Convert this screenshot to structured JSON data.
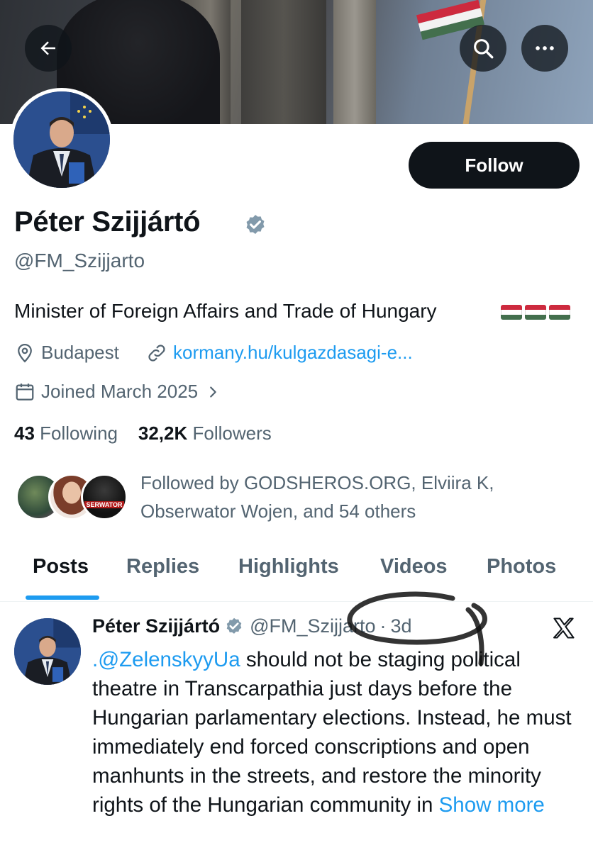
{
  "header": {
    "back_icon": "arrow-left-icon",
    "search_icon": "search-icon",
    "more_icon": "more-horizontal-icon"
  },
  "profile": {
    "name": "Péter Szijjártó",
    "handle": "@FM_Szijjarto",
    "follow_label": "Follow",
    "bio": "Minister of Foreign Affairs and Trade of Hungary",
    "bio_flags": [
      "hungary-flag",
      "hungary-flag",
      "hungary-flag"
    ],
    "location": "Budapest",
    "link": "kormany.hu/kulgazdasagi-e...",
    "joined": "Joined March 2025",
    "following_count": "43",
    "following_label": "Following",
    "followers_count": "32,2K",
    "followers_label": "Followers",
    "followed_by": "Followed by GODSHEROS.ORG, Elviira K, Obserwator Wojen, and 54 others",
    "follower_avatar_text": "SERWATOR"
  },
  "tabs": [
    {
      "label": "Posts",
      "active": true
    },
    {
      "label": "Replies",
      "active": false
    },
    {
      "label": "Highlights",
      "active": false
    },
    {
      "label": "Videos",
      "active": false
    },
    {
      "label": "Photos",
      "active": false
    }
  ],
  "post": {
    "author_name": "Péter Szijjártó",
    "author_handle": "@FM_Szijjarto",
    "separator": "·",
    "time": "3d",
    "mention": ".@ZelenskyyUa",
    "text": " should not be staging political theatre in Transcarpathia just days before the Hungarian parlamentary elections. Instead, he must immediately end forced conscriptions and open manhunts in the streets, and restore the minority rights of the Hungarian community in ",
    "show_more": "Show more"
  },
  "colors": {
    "accent": "#1d9bf0",
    "text": "#0f1419",
    "secondary": "#536471",
    "verified": "#829aab",
    "flag_red": "#cd2a3e",
    "flag_white": "#ffffff",
    "flag_green": "#436f4d"
  }
}
